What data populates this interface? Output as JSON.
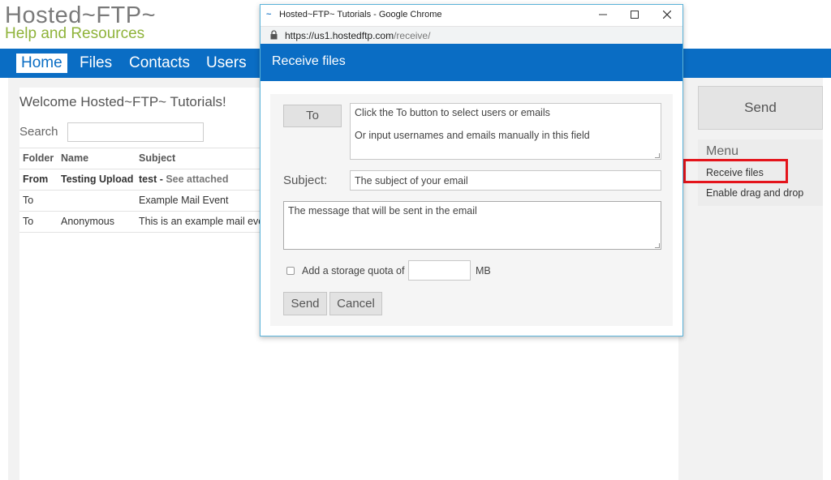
{
  "logo": {
    "line1": "Hosted~FTP~",
    "line2": "Help and Resources"
  },
  "nav": {
    "items": [
      {
        "label": "Home",
        "active": true
      },
      {
        "label": "Files",
        "active": false
      },
      {
        "label": "Contacts",
        "active": false
      },
      {
        "label": "Users",
        "active": false
      }
    ]
  },
  "main": {
    "welcome": "Welcome Hosted~FTP~ Tutorials!",
    "search_label": "Search",
    "search_value": "",
    "table": {
      "headers": [
        "Folder",
        "Name",
        "Subject"
      ],
      "rows": [
        {
          "folder": "From",
          "name": "Testing Upload",
          "subject": "test - ",
          "subject_extra": "See attached",
          "bold": true
        },
        {
          "folder": "To",
          "name": "",
          "subject": "Example Mail Event",
          "subject_extra": "",
          "bold": false
        },
        {
          "folder": "To",
          "name": "Anonymous",
          "subject": "This is an example mail eve",
          "subject_extra": "",
          "bold": false
        }
      ]
    }
  },
  "sidebar": {
    "send_label": "Send",
    "menu_title": "Menu",
    "menu_items": [
      "Receive files",
      "Enable drag and drop"
    ],
    "highlight_color": "#e4141b"
  },
  "popup": {
    "window_title": "Hosted~FTP~ Tutorials - Google Chrome",
    "window_icon": "~",
    "url_host": "https://us1.hostedftp.com",
    "url_path": "/receive/",
    "header_title": "Receive files",
    "header_color": "#0a6dc4",
    "form": {
      "to_button": "To",
      "to_hint_line1": "Click the To button to select users or emails",
      "to_hint_line2": "Or input usernames and emails manually in this field",
      "subject_label": "Subject:",
      "subject_placeholder": "The subject of your email",
      "message_placeholder": "The message that will be sent in the email",
      "quota_label": "Add a storage quota of",
      "quota_value": "",
      "quota_unit": "MB",
      "send_button": "Send",
      "cancel_button": "Cancel"
    }
  }
}
